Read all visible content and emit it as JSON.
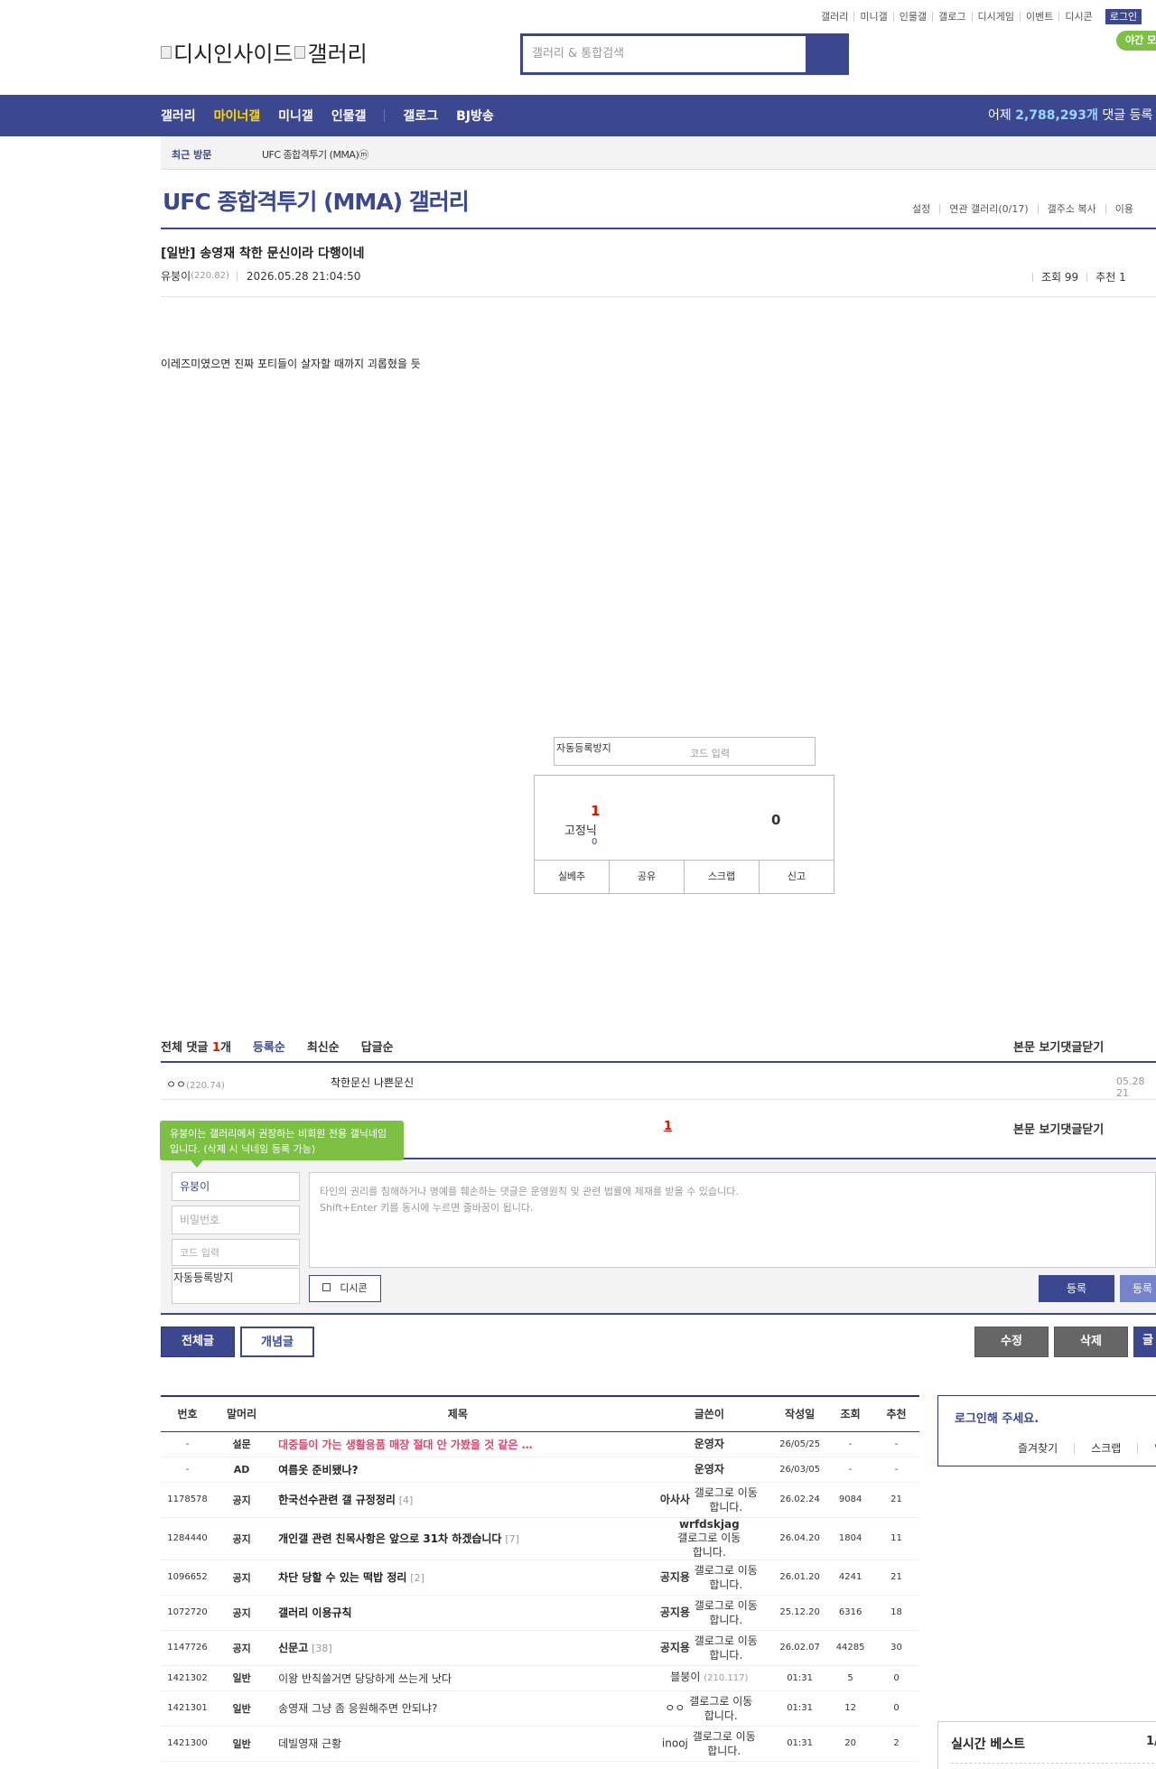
{
  "header": {
    "top_links": [
      "갤러리",
      "미니갤",
      "인물갤",
      "갤로그",
      "디시게임",
      "이벤트",
      "디시콘"
    ],
    "login": "로그인",
    "night_mode": "야간 모",
    "logo_text_1": "디시인사이드",
    "logo_text_2": "갤러리",
    "search_placeholder": "갤러리 & 통합검색"
  },
  "gnb": {
    "menu": [
      "갤러리",
      "마이너갤",
      "미니갤",
      "인물갤",
      "갤로그",
      "BJ방송"
    ],
    "stat_prefix": "어제",
    "stat_count": "2,788,293개",
    "stat_suffix": "댓글 등록"
  },
  "recent": {
    "label": "최근 방문",
    "item": "UFC 종합격투기 (MMA)ⓜ"
  },
  "gallery": {
    "title": "UFC 종합격투기 (MMA) 갤러리",
    "links": [
      "설정",
      "연관 갤러리(0/17)",
      "갤주소 복사",
      "이용"
    ]
  },
  "post": {
    "title": "[일반] 송영재 착한 문신이라 다행이네",
    "author": "유붕이",
    "author_ip": "(220.82)",
    "date": "2026.05.28 21:04:50",
    "views": "조회 99",
    "recommend": "추천 1",
    "body": "이레즈미였으면 진짜 포티들이 살자할 때까지 괴롭혔을 듯"
  },
  "captcha": {
    "image_alt": "자동등록방지",
    "placeholder": "코드 입력"
  },
  "vote": {
    "up": "1",
    "fixed_label": "고정닉",
    "fixed_count": "0",
    "down": "0",
    "buttons": [
      "실베추",
      "공유",
      "스크랩",
      "신고"
    ]
  },
  "comments": {
    "total_label": "전체 댓글",
    "total_count": "1",
    "total_unit": "개",
    "sort": [
      "등록순",
      "최신순",
      "답글순"
    ],
    "actions": [
      "본문 보기",
      "댓글닫기"
    ],
    "items": [
      {
        "nick": "ㅇㅇ",
        "ip": "(220.74)",
        "text": "착한문신 나쁜문신",
        "date": "05.28 21"
      }
    ],
    "page": "1",
    "tooltip": "유붕이는 갤러리에서 권장하는 비회원 전용 갤닉네임입니다. (삭제 시 닉네임 등록 가능)"
  },
  "write": {
    "nick": "유붕이",
    "password_placeholder": "비밀번호",
    "code_placeholder": "코드 입력",
    "captcha_alt": "자동등록방지",
    "textarea_line1": "타인의 권리를 침해하거나 명예를 훼손하는 댓글은 운영원칙 및 관련 법률에 제재를 받을 수 있습니다.",
    "textarea_line2": "Shift+Enter 키를 동시에 누르면 줄바꿈이 됩니다.",
    "dccon": "디시콘",
    "submit": "등록",
    "submit2": "등록"
  },
  "list_buttons": {
    "all": "전체글",
    "concept": "개념글",
    "edit": "수정",
    "delete": "삭제",
    "write": "글"
  },
  "board": {
    "headers": [
      "번호",
      "말머리",
      "제목",
      "글쓴이",
      "작성일",
      "조회",
      "추천"
    ],
    "rows": [
      {
        "num": "-",
        "sub": "설문",
        "title": "대중들이 가는 생활용품 매장 절대 안 가봤을 것 같은 …",
        "rc": "",
        "writer": "운영자",
        "ip": "",
        "glog": "",
        "date": "26/05/25",
        "views": "-",
        "rec": "-",
        "type": "survey"
      },
      {
        "num": "-",
        "sub": "AD",
        "title": "여름옷 준비됐나?",
        "rc": "",
        "writer": "운영자",
        "ip": "",
        "glog": "",
        "date": "26/03/05",
        "views": "-",
        "rec": "-",
        "type": "ad"
      },
      {
        "num": "1178578",
        "sub": "공지",
        "title": "한국선수관련 갤 규정정리",
        "rc": "[4]",
        "writer": "아사사",
        "ip": "",
        "glog": "갤로그로 이동합니다.",
        "date": "26.02.24",
        "views": "9084",
        "rec": "21",
        "type": "notice"
      },
      {
        "num": "1284440",
        "sub": "공지",
        "title": "개인갤 관련 친목사항은 앞으로 31차 하겠습니다",
        "rc": "[7]",
        "writer": "wrfdskjag",
        "ip": "",
        "glog": "갤로그로 이동합니다.",
        "date": "26.04.20",
        "views": "1804",
        "rec": "11",
        "type": "notice"
      },
      {
        "num": "1096652",
        "sub": "공지",
        "title": "차단 당할 수 있는 떡밥 정리",
        "rc": "[2]",
        "writer": "공지용",
        "ip": "",
        "glog": "갤로그로 이동합니다.",
        "date": "26.01.20",
        "views": "4241",
        "rec": "21",
        "type": "notice"
      },
      {
        "num": "1072720",
        "sub": "공지",
        "title": "갤러리 이용규칙",
        "rc": "",
        "writer": "공지용",
        "ip": "",
        "glog": "갤로그로 이동합니다.",
        "date": "25.12.20",
        "views": "6316",
        "rec": "18",
        "type": "notice"
      },
      {
        "num": "1147726",
        "sub": "공지",
        "title": "신문고",
        "rc": "[38]",
        "writer": "공지용",
        "ip": "",
        "glog": "갤로그로 이동합니다.",
        "date": "26.02.07",
        "views": "44285",
        "rec": "30",
        "type": "notice"
      },
      {
        "num": "1421302",
        "sub": "일반",
        "title": "이왕 반칙쓸거면 당당하게 쓰는게 낫다",
        "rc": "",
        "writer": "블붕이",
        "ip": "(210.117)",
        "glog": "",
        "date": "01:31",
        "views": "5",
        "rec": "0",
        "type": "normal"
      },
      {
        "num": "1421301",
        "sub": "일반",
        "title": "송영재 그냥 좀 응원해주면 안되냐?",
        "rc": "",
        "writer": "ㅇㅇ",
        "ip": "",
        "glog": "갤로그로 이동합니다.",
        "date": "01:31",
        "views": "12",
        "rec": "0",
        "type": "normal"
      },
      {
        "num": "1421300",
        "sub": "일반",
        "title": "데빌영재 근황",
        "rc": "",
        "writer": "inooj",
        "ip": "",
        "glog": "갤로그로 이동합니다.",
        "date": "01:31",
        "views": "20",
        "rec": "2",
        "type": "normal"
      }
    ]
  },
  "sidebar": {
    "login_prompt": "로그인해 주세요.",
    "login_links": [
      "즐겨찾기",
      "스크랩",
      "알림"
    ],
    "best_title": "실시간 베스트",
    "best_page": "1/"
  }
}
